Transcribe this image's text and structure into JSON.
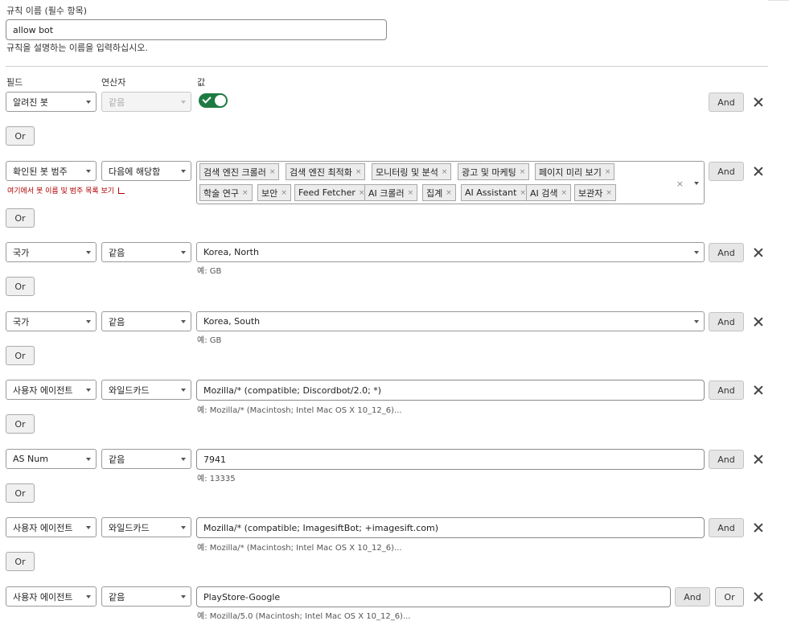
{
  "rule_name": {
    "label": "규칙 이름 (필수 항목)",
    "value": "allow bot",
    "helper": "규칙을 설명하는 이름을 입력하십시오."
  },
  "headers": {
    "field": "필드",
    "operator": "연산자",
    "value": "값"
  },
  "buttons": {
    "and": "And",
    "or": "Or"
  },
  "rows": [
    {
      "field": "알려진 봇",
      "operator": "같음",
      "value_toggle": true
    },
    {
      "field": "확인된 봇 범주",
      "operator": "다음에 해당함",
      "link": "여기에서 봇 이름 및 범주 목록 보기",
      "tags": [
        "검색 엔진 크롤러",
        "검색 엔진 최적화",
        "모니터링 및 분석",
        "광고 및 마케팅",
        "페이지 미리 보기",
        "학술 연구",
        "보안",
        "Feed Fetcher",
        "AI 크롤러",
        "집계",
        "AI Assistant",
        "AI 검색",
        "보관자"
      ]
    },
    {
      "field": "국가",
      "operator": "같음",
      "value": "Korea, North",
      "hint": "예: GB"
    },
    {
      "field": "국가",
      "operator": "같음",
      "value": "Korea, South",
      "hint": "예: GB"
    },
    {
      "field": "사용자 에이전트",
      "operator": "와일드카드",
      "value": "Mozilla/* (compatible; Discordbot/2.0; *)",
      "hint": "예: Mozilla/* (Macintosh; Intel Mac OS X 10_12_6)..."
    },
    {
      "field": "AS Num",
      "operator": "같음",
      "value": "7941",
      "hint": "예: 13335"
    },
    {
      "field": "사용자 에이전트",
      "operator": "와일드카드",
      "value": "Mozilla/* (compatible; ImagesiftBot; +imagesift.com)",
      "hint": "예: Mozilla/* (Macintosh; Intel Mac OS X 10_12_6)..."
    },
    {
      "field": "사용자 에이전트",
      "operator": "같음",
      "value": "PlayStore-Google",
      "hint": "예: Mozilla/5.0 (Macintosh; Intel Mac OS X 10_12_6)..."
    }
  ]
}
